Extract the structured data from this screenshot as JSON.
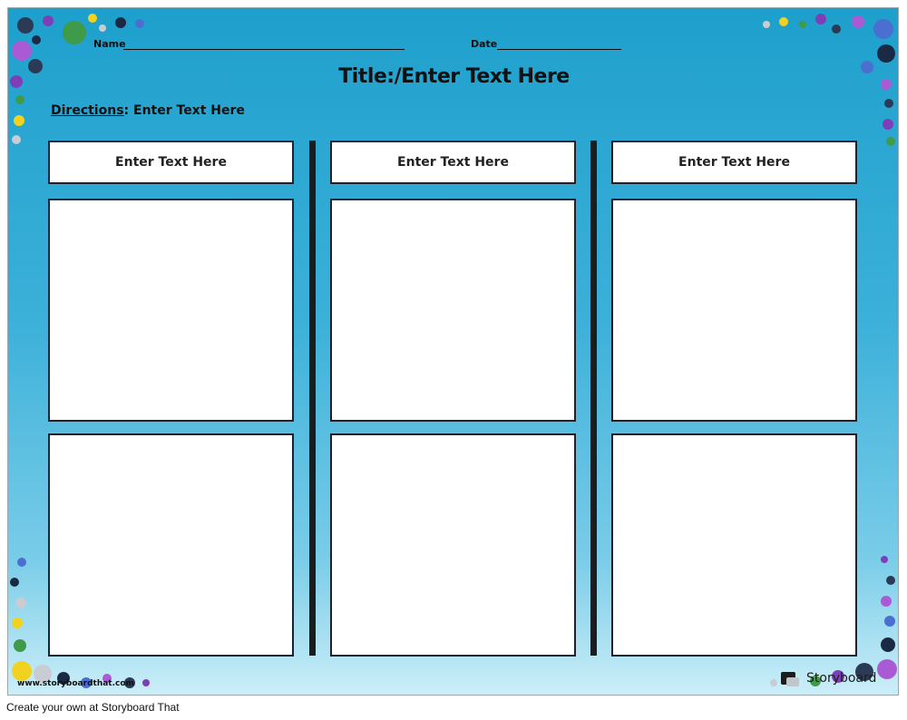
{
  "worksheet": {
    "name_label": "Name",
    "date_label": "Date",
    "title": "Title:/Enter Text Here",
    "directions_label": "Directions",
    "directions_text": ": Enter Text Here",
    "columns": [
      {
        "header": "Enter Text Here"
      },
      {
        "header": "Enter Text Here"
      },
      {
        "header": "Enter Text Here"
      }
    ]
  },
  "watermark": "www.storyboardthat.com",
  "logo": {
    "text": "Storyboard",
    "icon": "storyboard-logo-icon"
  },
  "footer": {
    "text": "Create your own at Storyboard That"
  },
  "colors": {
    "background_top": "#1ea0cc",
    "background_bottom": "#cbeef8",
    "box_border": "#1b2330",
    "divider": "#1c1c1c"
  }
}
